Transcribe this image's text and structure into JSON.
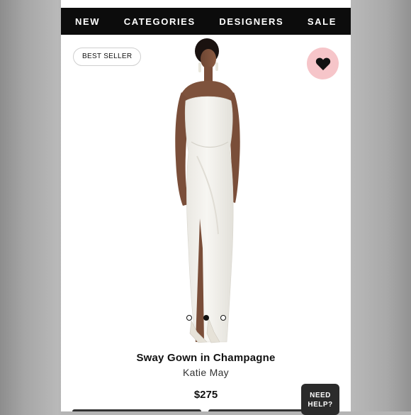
{
  "nav": {
    "items": [
      {
        "label": "NEW"
      },
      {
        "label": "CATEGORIES"
      },
      {
        "label": "DESIGNERS"
      },
      {
        "label": "SALE"
      }
    ]
  },
  "badge": {
    "label": "BEST SELLER"
  },
  "favorite": {
    "icon": "heart-icon"
  },
  "product": {
    "name": "Sway Gown in Champagne",
    "brand": "Katie May",
    "price": "$275"
  },
  "carousel": {
    "count": 3,
    "active_index": 1
  },
  "help": {
    "line1": "NEED",
    "line2": "HELP?"
  },
  "colors": {
    "nav_bg": "#0c0c0c",
    "favorite_bg": "#f6c5c9",
    "help_bg": "#2b2b2b"
  }
}
